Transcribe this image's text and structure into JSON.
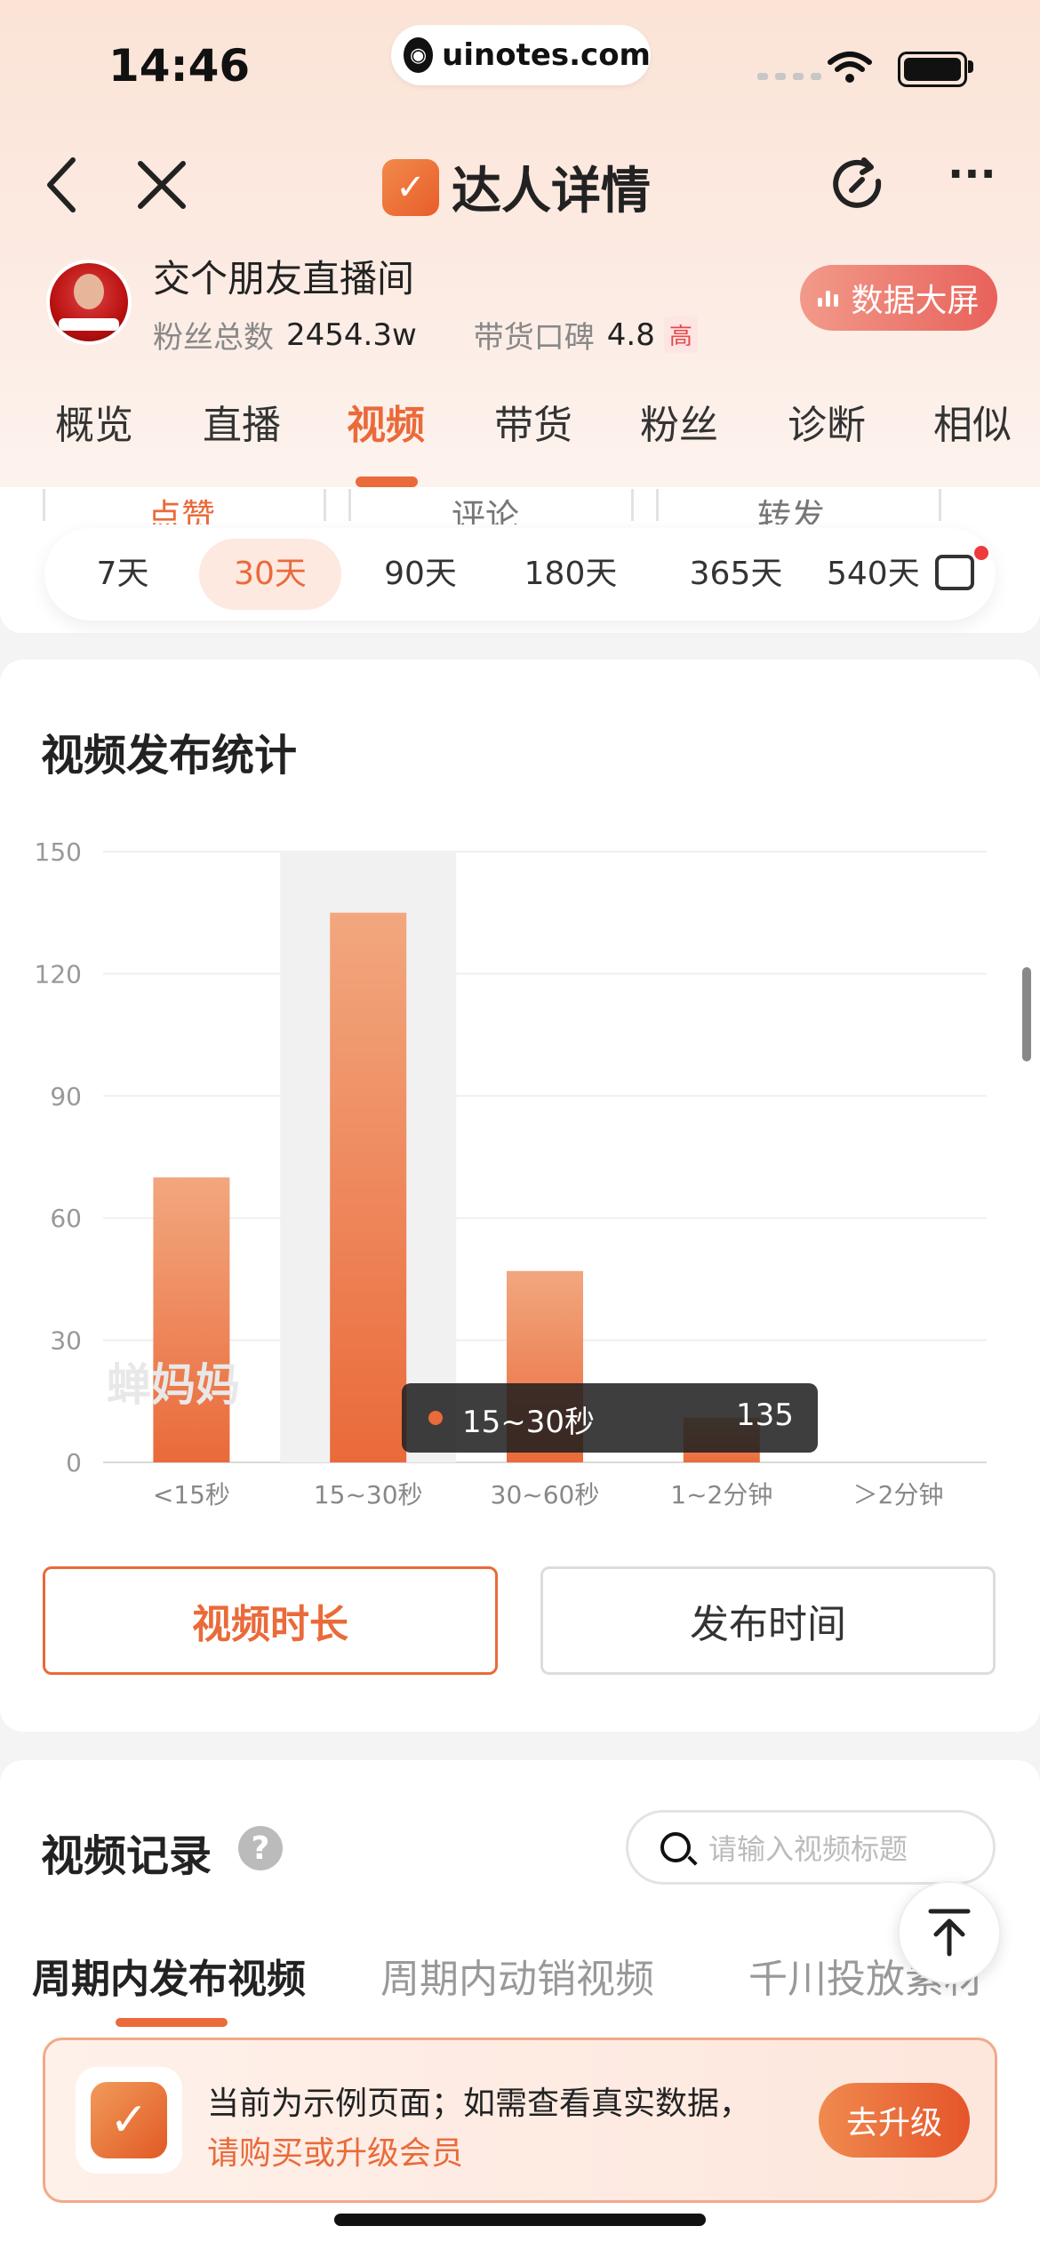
{
  "status": {
    "time": "14:46",
    "url": "uinotes.com"
  },
  "header": {
    "back_icon": "‹",
    "close_icon": "×",
    "title": "达人详情",
    "more_icon": "···"
  },
  "anchor": {
    "name": "交个朋友直播间",
    "fans_label": "粉丝总数",
    "fans_value": "2454.3w",
    "rep_label": "带货口碑",
    "rep_value": "4.8",
    "rep_level": "高",
    "screen_button": "数据大屏"
  },
  "tabs": [
    "概览",
    "直播",
    "视频",
    "带货",
    "粉丝",
    "诊断",
    "相似"
  ],
  "active_tab": 2,
  "peek_tabs": [
    "点赞",
    "评论",
    "转发"
  ],
  "date_ranges": [
    "7天",
    "30天",
    "90天",
    "180天",
    "365天",
    "540天"
  ],
  "selected_range": 1,
  "stats_section": {
    "title": "视频发布统计",
    "watermark": "蝉妈妈",
    "tooltip": {
      "label": "15~30秒",
      "value": "135"
    },
    "toggle_duration": "视频时长",
    "toggle_time": "发布时间"
  },
  "chart_data": {
    "type": "bar",
    "categories": [
      "<15秒",
      "15~30秒",
      "30~60秒",
      "1~2分钟",
      "＞2分钟"
    ],
    "values": [
      70,
      135,
      47,
      11,
      0
    ],
    "ylim": [
      0,
      150
    ],
    "yticks": [
      "0",
      "30",
      "60",
      "90",
      "120",
      "150"
    ],
    "highlighted_category": "15~30秒",
    "grid": true,
    "bar_color_top": "#f2a77f",
    "bar_color_bottom": "#ea6a3a"
  },
  "records": {
    "title": "视频记录",
    "help_icon": "?",
    "search_placeholder": "请输入视频标题",
    "tabs": [
      "周期内发布视频",
      "周期内动销视频",
      "千川投放素材"
    ]
  },
  "banner": {
    "line1": "当前为示例页面；如需查看真实数据，",
    "line2": "请购买或升级会员",
    "button": "去升级"
  },
  "colors": {
    "accent": "#ea6a3a"
  }
}
